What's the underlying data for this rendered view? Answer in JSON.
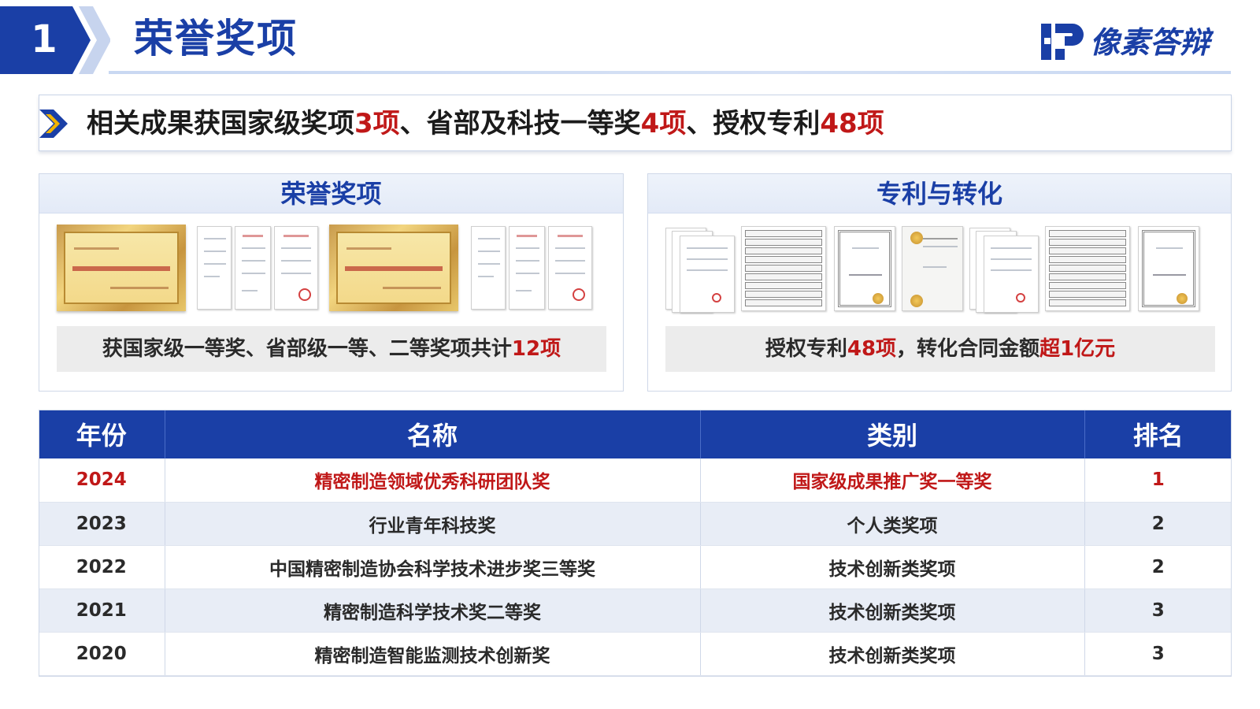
{
  "header": {
    "section_number": "1",
    "title": "荣誉奖项",
    "logo_text": "像素答辩",
    "accent_color": "#1a3fa6"
  },
  "summary": {
    "part1": "相关成果获国家级奖项",
    "num1": "3项",
    "part2": "、省部及科技一等奖",
    "num2": "4项",
    "part3": "、授权专利",
    "num3": "48项",
    "highlight_color": "#c01818"
  },
  "awards_panel": {
    "title": "荣誉奖项",
    "caption_text": "获国家级一等奖、省部级一等、二等奖项共计",
    "caption_highlight": "12项"
  },
  "patents_panel": {
    "title": "专利与转化",
    "caption_text1": "授权专利",
    "caption_num1": "48项",
    "caption_text2": "，转化合同金额",
    "caption_num2": "超1亿元"
  },
  "table": {
    "headers": [
      "年份",
      "名称",
      "类别",
      "排名"
    ],
    "rows": [
      {
        "year": "2024",
        "name": "精密制造领域优秀科研团队奖",
        "category": "国家级成果推广奖一等奖",
        "rank": "1"
      },
      {
        "year": "2023",
        "name": "行业青年科技奖",
        "category": "个人类奖项",
        "rank": "2"
      },
      {
        "year": "2022",
        "name": "中国精密制造协会科学技术进步奖三等奖",
        "category": "技术创新类奖项",
        "rank": "2"
      },
      {
        "year": "2021",
        "name": "精密制造科学技术奖二等奖",
        "category": "技术创新类奖项",
        "rank": "3"
      },
      {
        "year": "2020",
        "name": "精密制造智能监测技术创新奖",
        "category": "技术创新类奖项",
        "rank": "3"
      }
    ]
  }
}
